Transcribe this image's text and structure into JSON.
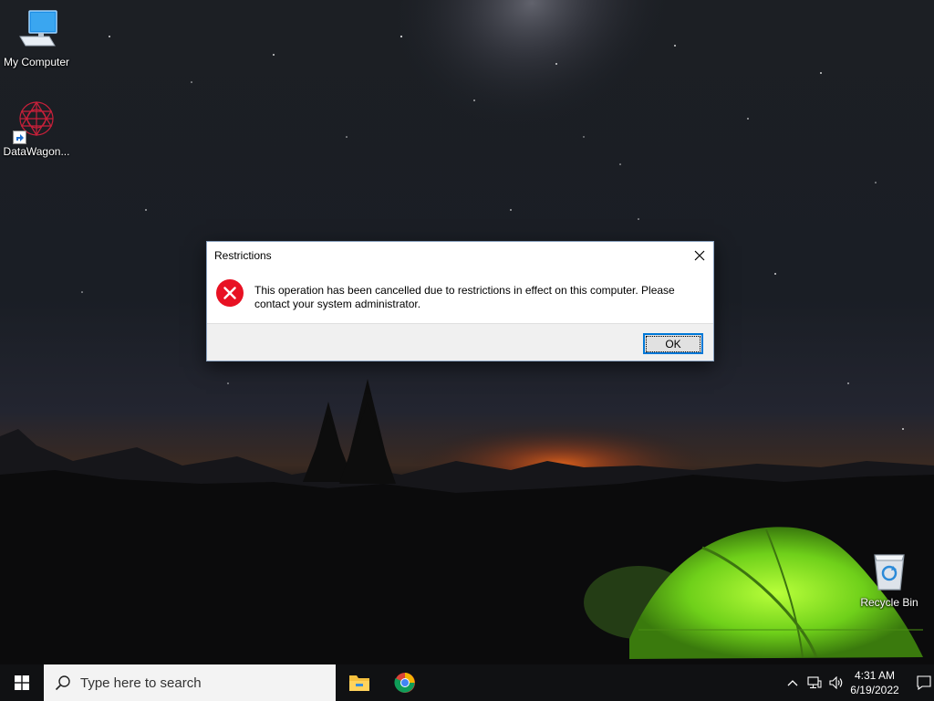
{
  "desktop": {
    "icons": [
      {
        "label": "My Computer",
        "icon": "monitor-icon"
      },
      {
        "label": "DataWagon...",
        "icon": "datawagon-icon"
      },
      {
        "label": "Recycle Bin",
        "icon": "recycle-bin-icon"
      }
    ]
  },
  "dialog": {
    "title": "Restrictions",
    "message": "This operation has been cancelled due to restrictions in effect on this computer. Please contact your system administrator.",
    "ok_label": "OK",
    "icon": "error-icon",
    "accent_color": "#0078d7",
    "error_color": "#e81123"
  },
  "taskbar": {
    "search_placeholder": "Type here to search",
    "pinned": [
      {
        "name": "File Explorer",
        "icon": "folder-icon"
      },
      {
        "name": "Google Chrome",
        "icon": "chrome-icon"
      }
    ],
    "tray": {
      "time": "4:31 AM",
      "date": "6/19/2022"
    }
  }
}
